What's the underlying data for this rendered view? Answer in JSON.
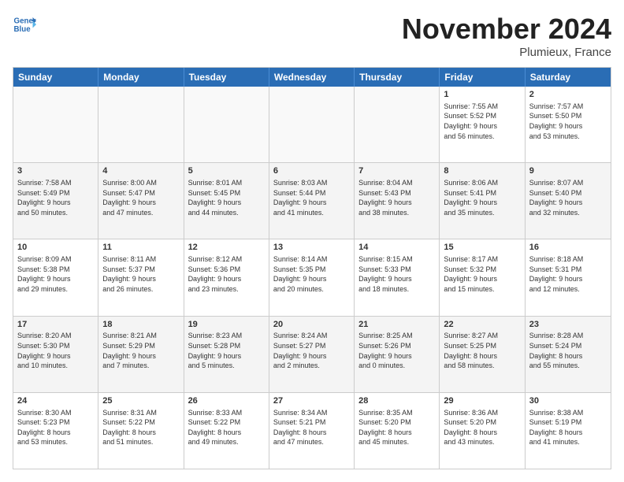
{
  "header": {
    "logo_line1": "General",
    "logo_line2": "Blue",
    "month": "November 2024",
    "location": "Plumieux, France"
  },
  "weekdays": [
    "Sunday",
    "Monday",
    "Tuesday",
    "Wednesday",
    "Thursday",
    "Friday",
    "Saturday"
  ],
  "rows": [
    [
      {
        "day": "",
        "info": ""
      },
      {
        "day": "",
        "info": ""
      },
      {
        "day": "",
        "info": ""
      },
      {
        "day": "",
        "info": ""
      },
      {
        "day": "",
        "info": ""
      },
      {
        "day": "1",
        "info": "Sunrise: 7:55 AM\nSunset: 5:52 PM\nDaylight: 9 hours\nand 56 minutes."
      },
      {
        "day": "2",
        "info": "Sunrise: 7:57 AM\nSunset: 5:50 PM\nDaylight: 9 hours\nand 53 minutes."
      }
    ],
    [
      {
        "day": "3",
        "info": "Sunrise: 7:58 AM\nSunset: 5:49 PM\nDaylight: 9 hours\nand 50 minutes."
      },
      {
        "day": "4",
        "info": "Sunrise: 8:00 AM\nSunset: 5:47 PM\nDaylight: 9 hours\nand 47 minutes."
      },
      {
        "day": "5",
        "info": "Sunrise: 8:01 AM\nSunset: 5:45 PM\nDaylight: 9 hours\nand 44 minutes."
      },
      {
        "day": "6",
        "info": "Sunrise: 8:03 AM\nSunset: 5:44 PM\nDaylight: 9 hours\nand 41 minutes."
      },
      {
        "day": "7",
        "info": "Sunrise: 8:04 AM\nSunset: 5:43 PM\nDaylight: 9 hours\nand 38 minutes."
      },
      {
        "day": "8",
        "info": "Sunrise: 8:06 AM\nSunset: 5:41 PM\nDaylight: 9 hours\nand 35 minutes."
      },
      {
        "day": "9",
        "info": "Sunrise: 8:07 AM\nSunset: 5:40 PM\nDaylight: 9 hours\nand 32 minutes."
      }
    ],
    [
      {
        "day": "10",
        "info": "Sunrise: 8:09 AM\nSunset: 5:38 PM\nDaylight: 9 hours\nand 29 minutes."
      },
      {
        "day": "11",
        "info": "Sunrise: 8:11 AM\nSunset: 5:37 PM\nDaylight: 9 hours\nand 26 minutes."
      },
      {
        "day": "12",
        "info": "Sunrise: 8:12 AM\nSunset: 5:36 PM\nDaylight: 9 hours\nand 23 minutes."
      },
      {
        "day": "13",
        "info": "Sunrise: 8:14 AM\nSunset: 5:35 PM\nDaylight: 9 hours\nand 20 minutes."
      },
      {
        "day": "14",
        "info": "Sunrise: 8:15 AM\nSunset: 5:33 PM\nDaylight: 9 hours\nand 18 minutes."
      },
      {
        "day": "15",
        "info": "Sunrise: 8:17 AM\nSunset: 5:32 PM\nDaylight: 9 hours\nand 15 minutes."
      },
      {
        "day": "16",
        "info": "Sunrise: 8:18 AM\nSunset: 5:31 PM\nDaylight: 9 hours\nand 12 minutes."
      }
    ],
    [
      {
        "day": "17",
        "info": "Sunrise: 8:20 AM\nSunset: 5:30 PM\nDaylight: 9 hours\nand 10 minutes."
      },
      {
        "day": "18",
        "info": "Sunrise: 8:21 AM\nSunset: 5:29 PM\nDaylight: 9 hours\nand 7 minutes."
      },
      {
        "day": "19",
        "info": "Sunrise: 8:23 AM\nSunset: 5:28 PM\nDaylight: 9 hours\nand 5 minutes."
      },
      {
        "day": "20",
        "info": "Sunrise: 8:24 AM\nSunset: 5:27 PM\nDaylight: 9 hours\nand 2 minutes."
      },
      {
        "day": "21",
        "info": "Sunrise: 8:25 AM\nSunset: 5:26 PM\nDaylight: 9 hours\nand 0 minutes."
      },
      {
        "day": "22",
        "info": "Sunrise: 8:27 AM\nSunset: 5:25 PM\nDaylight: 8 hours\nand 58 minutes."
      },
      {
        "day": "23",
        "info": "Sunrise: 8:28 AM\nSunset: 5:24 PM\nDaylight: 8 hours\nand 55 minutes."
      }
    ],
    [
      {
        "day": "24",
        "info": "Sunrise: 8:30 AM\nSunset: 5:23 PM\nDaylight: 8 hours\nand 53 minutes."
      },
      {
        "day": "25",
        "info": "Sunrise: 8:31 AM\nSunset: 5:22 PM\nDaylight: 8 hours\nand 51 minutes."
      },
      {
        "day": "26",
        "info": "Sunrise: 8:33 AM\nSunset: 5:22 PM\nDaylight: 8 hours\nand 49 minutes."
      },
      {
        "day": "27",
        "info": "Sunrise: 8:34 AM\nSunset: 5:21 PM\nDaylight: 8 hours\nand 47 minutes."
      },
      {
        "day": "28",
        "info": "Sunrise: 8:35 AM\nSunset: 5:20 PM\nDaylight: 8 hours\nand 45 minutes."
      },
      {
        "day": "29",
        "info": "Sunrise: 8:36 AM\nSunset: 5:20 PM\nDaylight: 8 hours\nand 43 minutes."
      },
      {
        "day": "30",
        "info": "Sunrise: 8:38 AM\nSunset: 5:19 PM\nDaylight: 8 hours\nand 41 minutes."
      }
    ]
  ]
}
